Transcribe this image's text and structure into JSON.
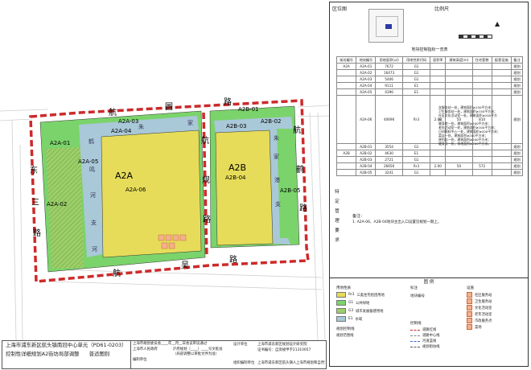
{
  "map": {
    "road_north": [
      "航",
      "圆",
      "路"
    ],
    "road_east": [
      "航",
      "鹤",
      "路"
    ],
    "road_west": [
      "东",
      "三",
      "路"
    ],
    "road_south": [
      "航",
      "吴",
      "路"
    ],
    "road_middle": [
      "航",
      "规",
      "路"
    ],
    "river_west": [
      "鹤",
      "鸣",
      "河",
      "支",
      "河"
    ],
    "river_east": [
      "朱",
      "家",
      "港",
      "支"
    ],
    "river_north": [
      "朱",
      "家"
    ],
    "block_a": "A2A",
    "block_b": "A2B",
    "plots": {
      "a01": "A2A-01",
      "a02": "A2A-02",
      "a03": "A2A-03",
      "a04": "A2A-04",
      "a05": "A2A-05",
      "a06": "A2A-06",
      "b01": "A2B-01",
      "b02": "A2B-02",
      "b03": "A2B-03",
      "b04": "A2B-04",
      "b05": "A2B-05"
    },
    "colors": {
      "residential": "#e6dc5a",
      "green": "#7bd36b",
      "water": "#a9c8d8",
      "road_line": "#cc2a2a",
      "hatch_green": "#9ccf68"
    }
  },
  "title_block": {
    "line1": "上海市浦东新区航头镇南冠中心单元（PD61-0203）",
    "line2": "控制性详细规划A2街坊局部调整",
    "line2_suffix": "普适图则"
  },
  "info_block": {
    "approval": "上海市规划委员会____年__月__日会议审议通过",
    "gov": "上海市人民政府",
    "doc": "沪府规划〔____〕____号文批准",
    "doc2": "（局部调整以审批文件为准）",
    "org_label": "编制单位",
    "design_label": "设计单位",
    "design_org": "上海市浦东新区规划设计研究院",
    "cert": "证书编号：自资规甲字21310057",
    "footer_left": "组织编制单位",
    "footer_mid": "上海市浦东新区航头镇人民政府",
    "footer_right": "上海市规划和自然资源局"
  },
  "panel": {
    "area_label": "区位图",
    "scale_label": "比例尺",
    "table_title": "地块控制指标一览表",
    "table_headers": [
      "街坊编号",
      "地块编号",
      "用地面积(㎡)",
      "用地性质代码",
      "容积率",
      "建筑高度(m)",
      "住宅套数",
      "配套设施",
      "备注"
    ],
    "table_rows": [
      [
        "A2A",
        "A2A-01",
        "7672",
        "G1",
        "",
        "",
        "",
        "",
        "规划"
      ],
      [
        "",
        "A2A-02",
        "16473",
        "G1",
        "",
        "",
        "",
        "",
        "规划"
      ],
      [
        "",
        "A2A-03",
        "5406",
        "G1",
        "",
        "",
        "",
        "",
        "规划"
      ],
      [
        "",
        "A2A-04",
        "9111",
        "E1",
        "",
        "",
        "",
        "",
        "规划"
      ],
      [
        "",
        "A2A-05",
        "4396",
        "E1",
        "",
        "",
        "",
        "",
        "规划"
      ],
      [
        "",
        "A2A-06",
        "40696",
        "Rr3",
        "2.00",
        "50",
        "810",
        "",
        "规划"
      ],
      [
        "",
        "A2B-01",
        "3554",
        "G1",
        "",
        "",
        "",
        "",
        "规划"
      ],
      [
        "A2B",
        "A2B-02",
        "4630",
        "E1",
        "",
        "",
        "",
        "",
        "规划"
      ],
      [
        "",
        "A2B-03",
        "2721",
        "G1",
        "",
        "",
        "",
        "",
        "规划"
      ],
      [
        "",
        "A2B-04",
        "26656",
        "Rr3",
        "2.00",
        "50",
        "572",
        "",
        "规划"
      ],
      [
        "",
        "A2B-05",
        "3241",
        "G1",
        "",
        "",
        "",
        "",
        "规划"
      ]
    ],
    "facility_notes": [
      "含服务站一处，建筑面积≥150平方米；",
      "卫生服务站一处，建筑面积≥150平方米；",
      "社区文化活动室一处，建筑面积≥200平方米；",
      "健身房一处，建筑面积≥200平方米；",
      "老年活动室一处，建筑面积≥100平方米；",
      "日间照料中心一处，建筑面积≥200平方米；",
      "菜店一处，建筑面积≥200平方米；",
      "便利店一处，建筑面积≥200平方米；",
      "健身点一处，场地面积≥200平方米。"
    ],
    "special_label": [
      "特",
      "定",
      "管",
      "理",
      "要",
      "求"
    ],
    "special_notes_title": "备注：",
    "special_note": "1. A2A-06、A2B-04地块主出入口设置见规划一期上。",
    "legend_title": "图 例",
    "legend_land_title": "用地性质",
    "legend_land": [
      {
        "code": "Rr3",
        "label": "三类住宅组团用地",
        "color": "#e6dc5a"
      },
      {
        "code": "G1",
        "label": "公共绿地",
        "color": "#7bd36b"
      },
      {
        "code": "G3",
        "label": "城市发展备建用地",
        "color": "#9ccf68"
      },
      {
        "code": "E1",
        "label": "水域",
        "color": "#a9c8d8"
      }
    ],
    "legend_mark_title": "标注",
    "legend_mark": "地块编号",
    "legend_fac_title": "设施",
    "legend_fac": [
      "社区服务站",
      "卫生服务站",
      "文化活动室",
      "老年活动室",
      "市政服务点",
      "菜场"
    ],
    "legend_ctrl_title": "规划控制线",
    "legend_ctrl": [
      "规划范围线"
    ],
    "legend_line_title": "控制线",
    "legend_line": [
      "道路红线",
      "道路中心线",
      "河道蓝线",
      "规划街坊线"
    ]
  }
}
